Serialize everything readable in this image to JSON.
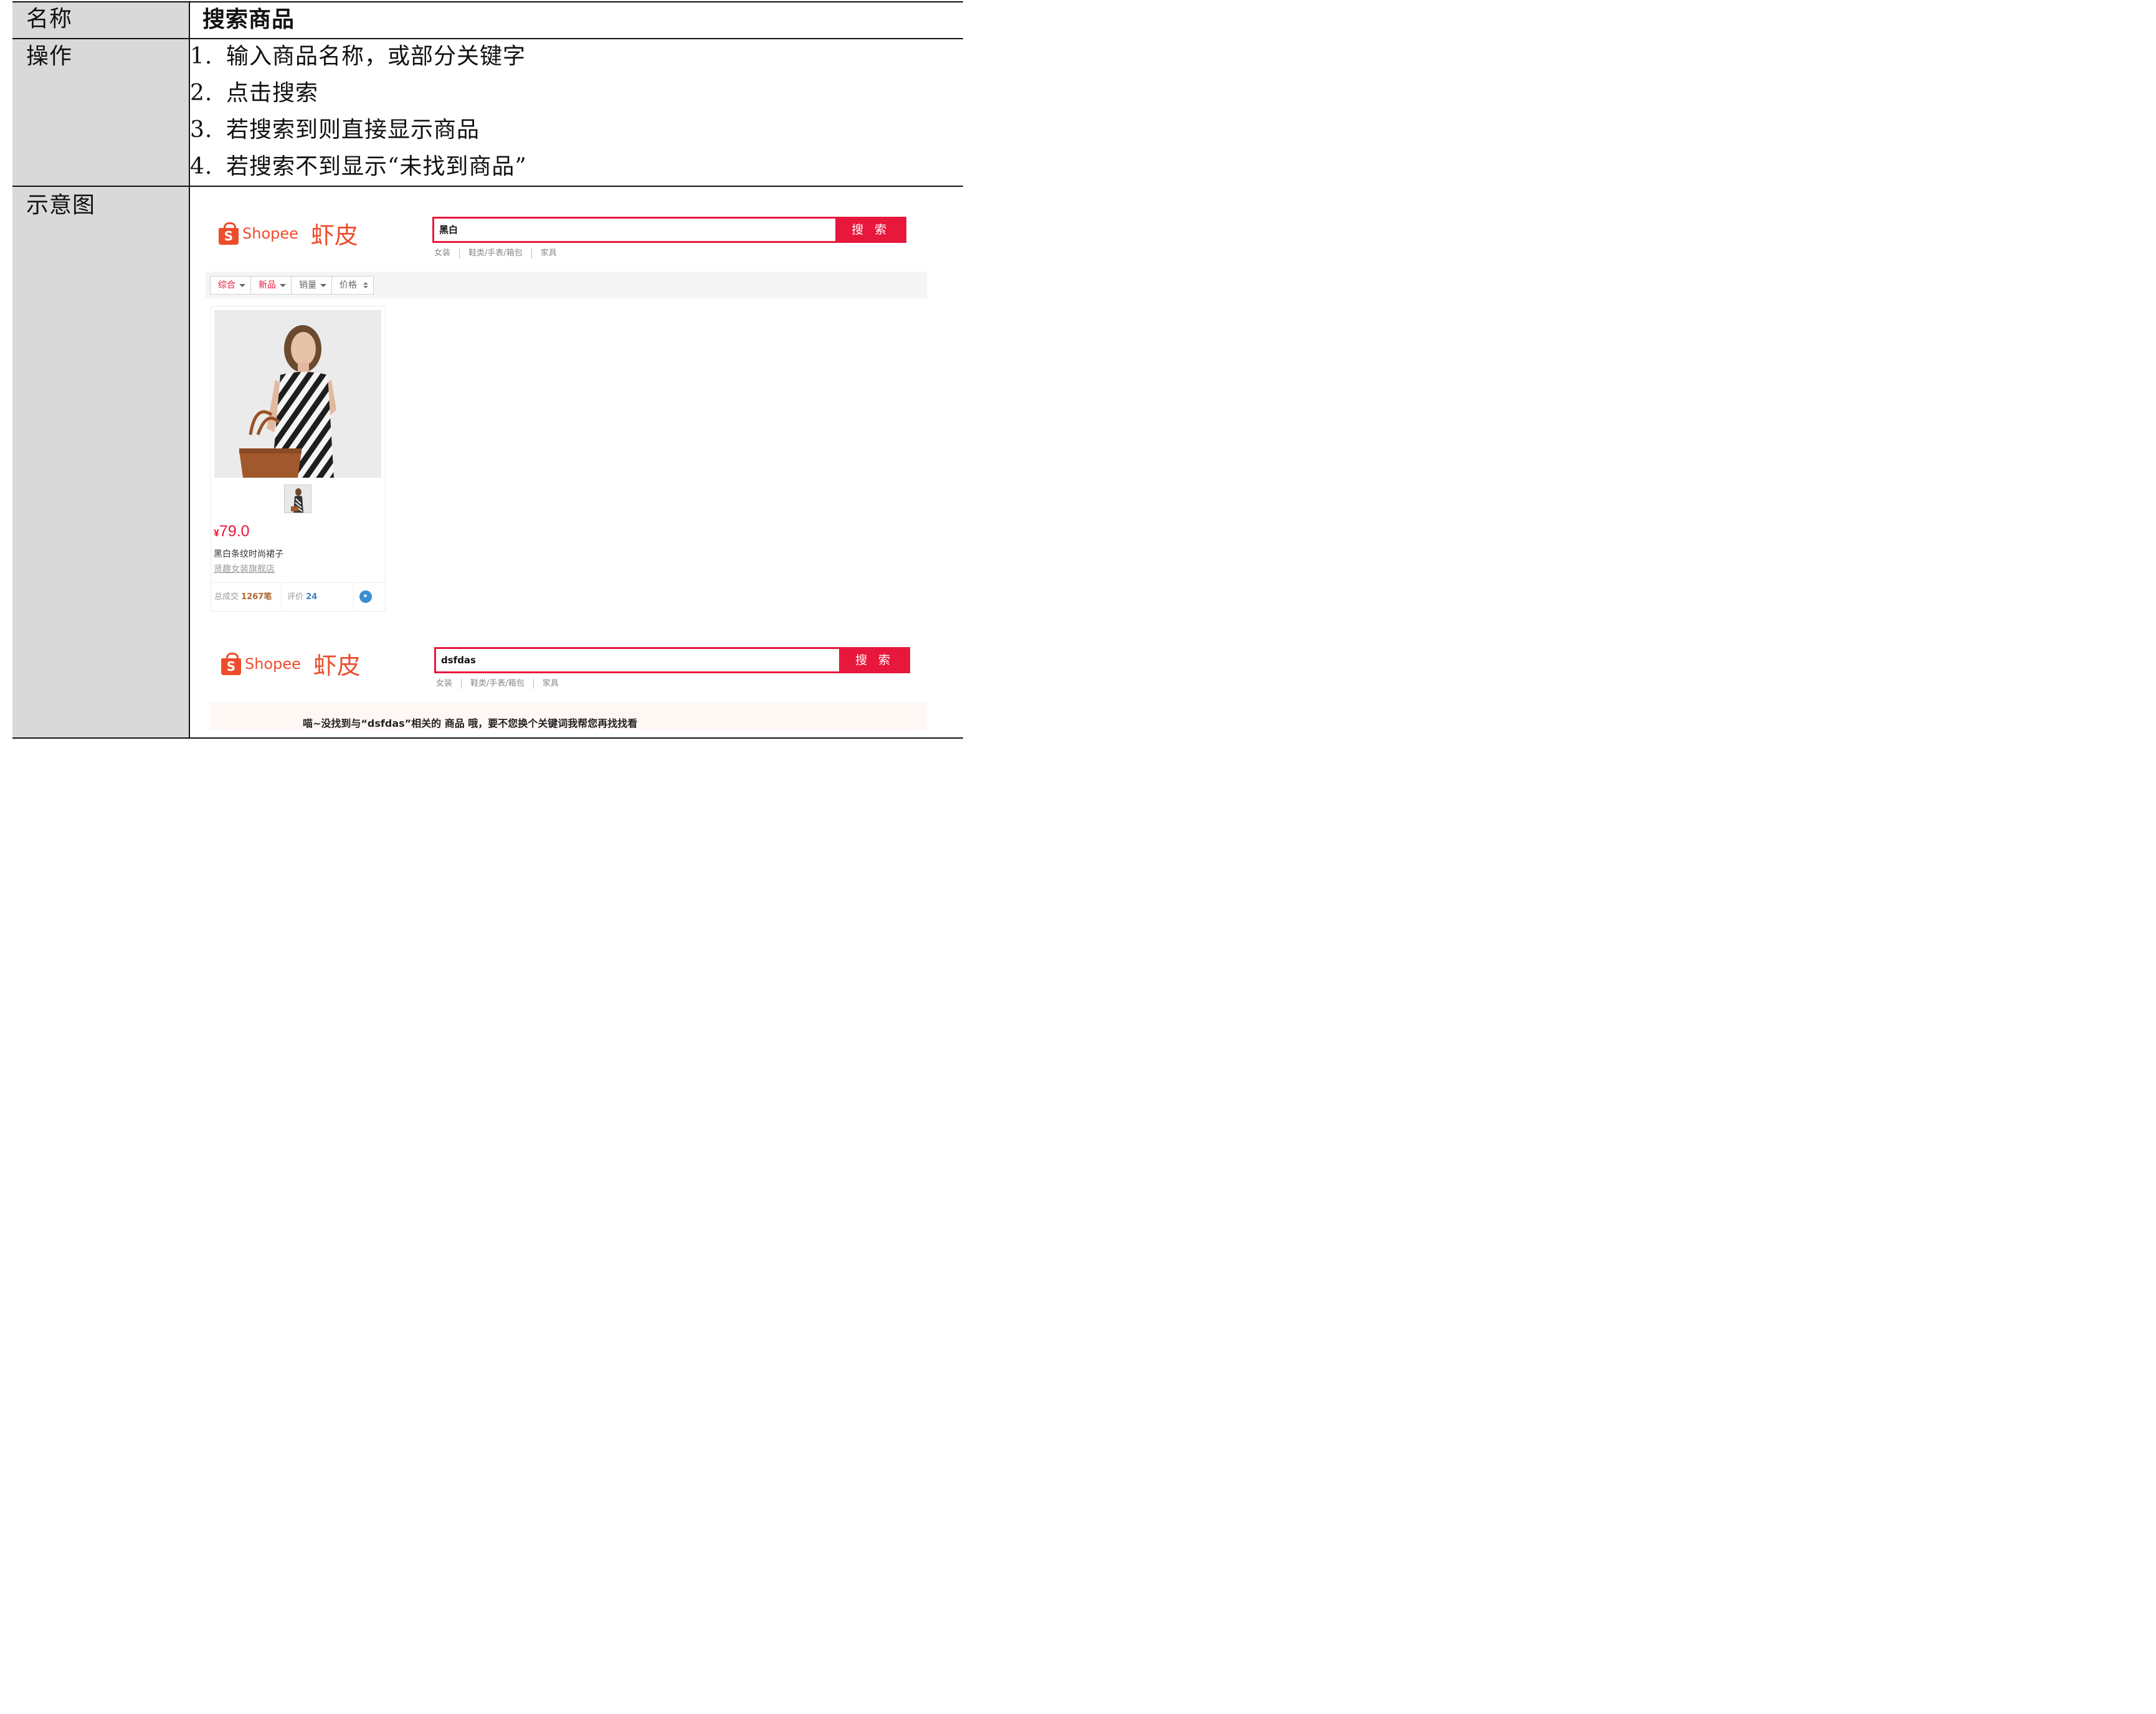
{
  "table": {
    "row_name": {
      "label": "名称",
      "value": "搜索商品"
    },
    "row_ops": {
      "label": "操作",
      "steps": [
        {
          "num": "1.",
          "text": "输入商品名称，或部分关键字"
        },
        {
          "num": "2.",
          "text": "点击搜索"
        },
        {
          "num": "3.",
          "text": "若搜索到则直接显示商品"
        },
        {
          "num": "4.",
          "text": "若搜索不到显示“未找到商品”"
        }
      ]
    },
    "row_fig": {
      "label": "示意图"
    }
  },
  "mock1": {
    "logo_text": "Shopee",
    "logo_cn": "虾皮",
    "logo_bag_letter": "S",
    "search_query": "黑白",
    "search_button": "搜 索",
    "hot_links": [
      "女装",
      "鞋类/手表/箱包",
      "家具"
    ],
    "filters": [
      "综合",
      "新品",
      "销量",
      "价格"
    ],
    "product": {
      "currency": "¥",
      "price": "79.0",
      "title": "黑白条纹时尚裙子",
      "shop": "贤趣女装旗舰店",
      "sales_label": "总成交",
      "sales_value": "1267笔",
      "reviews_label": "评价",
      "reviews_value": "24"
    }
  },
  "mock2": {
    "logo_text": "Shopee",
    "logo_cn": "虾皮",
    "logo_bag_letter": "S",
    "search_query": "dsfdas",
    "search_button": "搜 索",
    "hot_links": [
      "女装",
      "鞋类/手表/箱包",
      "家具"
    ],
    "not_found_message": "喵~没找到与“dsfdas”相关的 商品 哦，要不您换个关键词我帮您再找找看"
  },
  "colors": {
    "shopee_orange": "#ee4d2d",
    "search_red": "#e8173c",
    "label_gray": "#d9d9d9"
  },
  "icons": [
    "shopee-bag-icon",
    "caret-down-icon",
    "sort-updown-icon",
    "chat-icon"
  ]
}
